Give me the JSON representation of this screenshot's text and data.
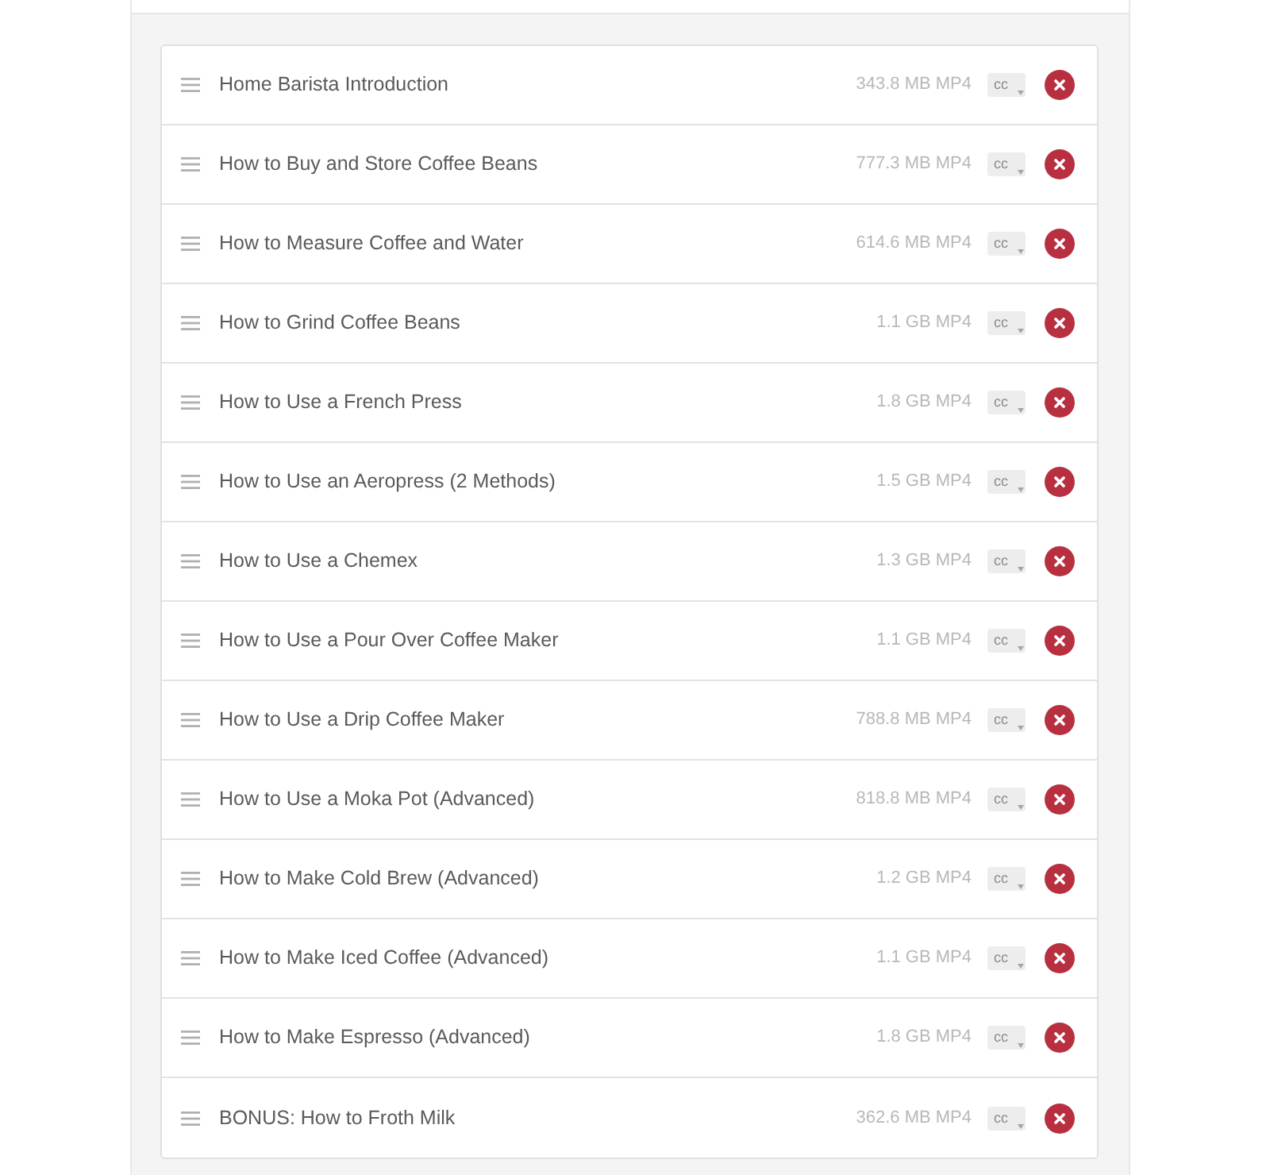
{
  "videos": [
    {
      "title": "Home Barista Introduction",
      "size": "343.8 MB MP4",
      "captions": "cc"
    },
    {
      "title": "How to Buy and Store Coffee Beans",
      "size": "777.3 MB MP4",
      "captions": "cc"
    },
    {
      "title": "How to Measure Coffee and Water",
      "size": "614.6 MB MP4",
      "captions": "cc"
    },
    {
      "title": "How to Grind Coffee Beans",
      "size": "1.1 GB MP4",
      "captions": "cc"
    },
    {
      "title": "How to Use a French Press",
      "size": "1.8 GB MP4",
      "captions": "cc"
    },
    {
      "title": "How to Use an Aeropress (2 Methods)",
      "size": "1.5 GB MP4",
      "captions": "cc"
    },
    {
      "title": "How to Use a Chemex",
      "size": "1.3 GB MP4",
      "captions": "cc"
    },
    {
      "title": "How to Use a Pour Over Coffee Maker",
      "size": "1.1 GB MP4",
      "captions": "cc"
    },
    {
      "title": "How to Use a Drip Coffee Maker",
      "size": "788.8 MB MP4",
      "captions": "cc"
    },
    {
      "title": "How to Use a Moka Pot (Advanced)",
      "size": "818.8 MB MP4",
      "captions": "cc"
    },
    {
      "title": "How to Make Cold Brew (Advanced)",
      "size": "1.2 GB MP4",
      "captions": "cc"
    },
    {
      "title": "How to Make Iced Coffee (Advanced)",
      "size": "1.1 GB MP4",
      "captions": "cc"
    },
    {
      "title": "How to Make Espresso (Advanced)",
      "size": "1.8 GB MP4",
      "captions": "cc"
    },
    {
      "title": "BONUS: How to Froth Milk",
      "size": "362.6 MB MP4",
      "captions": "cc"
    }
  ]
}
